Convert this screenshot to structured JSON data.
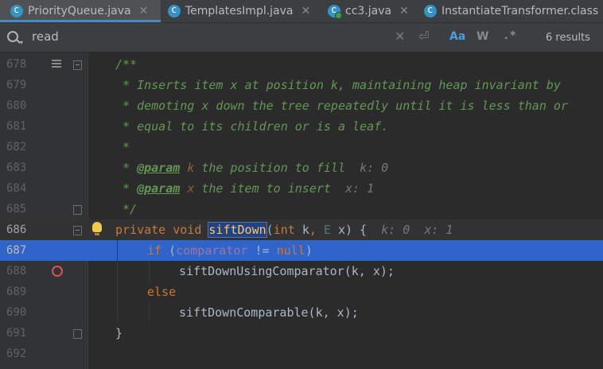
{
  "tabs": [
    {
      "label": "PriorityQueue.java",
      "active": true
    },
    {
      "label": "TemplatesImpl.java",
      "active": false
    },
    {
      "label": "cc3.java",
      "active": false
    },
    {
      "label": "InstantiateTransformer.class",
      "active": false
    }
  ],
  "search": {
    "query": "read",
    "match_case": "Aa",
    "words": "W",
    "regex": ".*",
    "results": "6 results"
  },
  "editor": {
    "lines": [
      "678",
      "679",
      "680",
      "681",
      "682",
      "683",
      "684",
      "685",
      "686",
      "687",
      "688",
      "689",
      "690",
      "691",
      "692"
    ],
    "text": {
      "l678": "/**",
      "l679": " * Inserts item x at position k, maintaining heap invariant by",
      "l680": " * demoting x down the tree repeatedly until it is less than or",
      "l681": " * equal to its children or is a leaf.",
      "l682": " *",
      "l683_tag": "@param",
      "l683_p": "k",
      "l683_rest": " the position to fill",
      "l683_hint": "k: 0",
      "l684_tag": "@param",
      "l684_p": "x",
      "l684_rest": " the item to insert",
      "l684_hint": "x: 1",
      "l685": " */",
      "l686_private": "private",
      "l686_void": "void",
      "l686_name": "siftDown",
      "l686_int": "int",
      "l686_k": "k",
      "l686_E": "E",
      "l686_x": "x",
      "l686_hint_k": "k: 0",
      "l686_hint_x": "x: 1",
      "l687_if": "if",
      "l687_field": "comparator",
      "l687_op": "!=",
      "l687_null": "null",
      "l688": "siftDownUsingComparator(k, x);",
      "l689": "else",
      "l690": "siftDownComparable(k, x);",
      "l691": "}"
    }
  }
}
